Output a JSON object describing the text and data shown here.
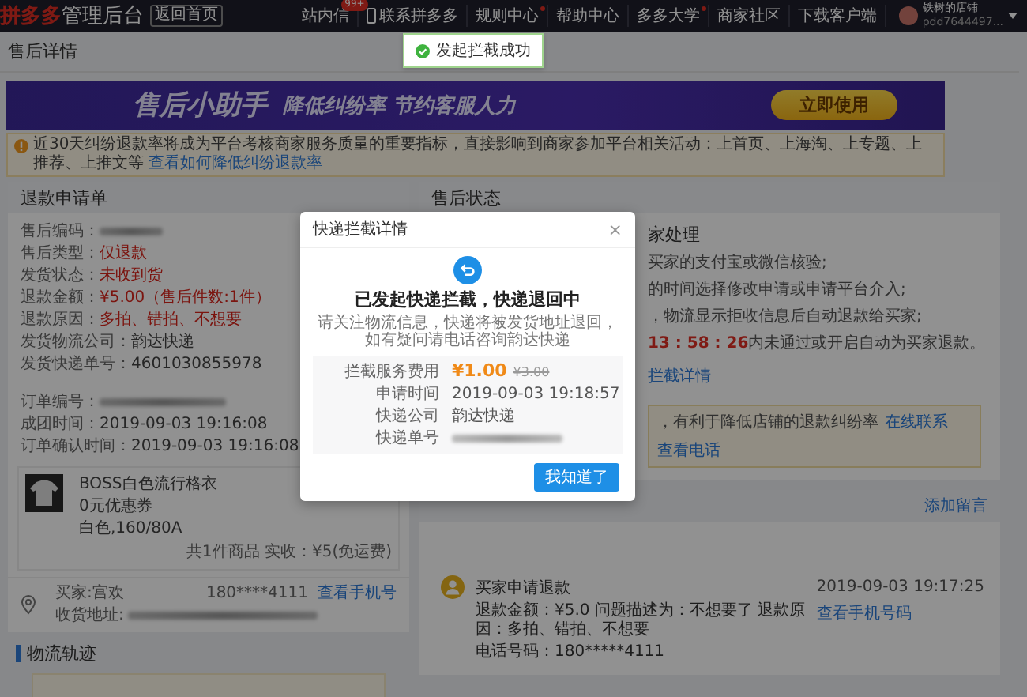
{
  "topbar": {
    "brand": "拼多多",
    "title": "管理后台",
    "home_button": "返回首页",
    "nav": [
      {
        "label": "站内信",
        "kind": "text",
        "badge": "99+",
        "dot": false
      },
      {
        "label": "联系拼多多",
        "kind": "phone",
        "dot": false
      },
      {
        "label": "规则中心",
        "kind": "text",
        "dot": true
      },
      {
        "label": "帮助中心",
        "kind": "text",
        "dot": false
      },
      {
        "label": "多多大学",
        "kind": "text",
        "dot": true
      },
      {
        "label": "商家社区",
        "kind": "text",
        "dot": false
      },
      {
        "label": "下载客户端",
        "kind": "text",
        "dot": false
      }
    ],
    "user": {
      "name": "铁树的店铺",
      "id": "pdd7644497..."
    }
  },
  "page_title": "售后详情",
  "banner": {
    "title": "售后小助手",
    "slogan": "降低纠纷率 节约客服人力",
    "button": "立即使用"
  },
  "notice": {
    "text": "近30天纠纷退款率将成为平台考核商家服务质量的重要指标，直接影响到商家参加平台相关活动：上首页、上海淘、上专题、上推荐、上推文等",
    "link": "查看如何降低纠纷退款率"
  },
  "refund_panel": {
    "title": "退款申请单",
    "rows": [
      {
        "label": "售后编码：",
        "kind": "blurred"
      },
      {
        "label": "售后类型：",
        "kind": "text",
        "value": "仅退款",
        "emphasis": true
      },
      {
        "label": "发货状态：",
        "kind": "text",
        "value": "未收到货",
        "emphasis": true
      },
      {
        "label": "退款金额：",
        "kind": "text",
        "value": "¥5.00（售后件数:1件）",
        "emphasis": true
      },
      {
        "label": "退款原因：",
        "kind": "text",
        "value": "多拍、错拍、不想要",
        "emphasis": true
      },
      {
        "label": "发货物流公司：",
        "kind": "text",
        "value": "韵达快递",
        "emphasis": false
      },
      {
        "label": "发货快递单号：",
        "kind": "text",
        "value": "4601030855978",
        "emphasis": false
      }
    ],
    "order_rows": [
      {
        "label": "订单编号：",
        "kind": "blurred"
      },
      {
        "label": "成团时间：",
        "kind": "text",
        "value": "2019-09-03 19:16:08"
      },
      {
        "label": "订单确认时间：",
        "kind": "text",
        "value": "2019-09-03 19:16:08"
      }
    ],
    "product": {
      "name": "BOSS白色流行格衣",
      "coupon": "0元优惠券",
      "spec": "白色,160/80A",
      "summary": "共1件商品  实收：¥5(免运费)"
    },
    "address": {
      "buyer": "买家:宫欢",
      "phone": "180****4111",
      "phone_link": "查看手机号",
      "address_label": "收货地址:"
    }
  },
  "logistics_title": "物流轨迹",
  "status_panel": {
    "title": "售后状态",
    "heading": "家处理",
    "lines": [
      "买家的支付宝或微信核验;",
      "的时间选择修改申请或申请平台介入;",
      "，物流显示拒收信息后自动退款给买家;"
    ],
    "countdown": "13 : 58 : 26",
    "countdown_text": "内未通过或开启自动为买家退款。",
    "detail_link": "拦截详情",
    "tip": {
      "text": "，有利于降低店铺的退款纠纷率",
      "links": [
        "在线联系",
        "查看电话"
      ]
    }
  },
  "message_panel": {
    "add_link": "添加留言",
    "entries": [
      {
        "title": "买家申请退款",
        "time": "2019-09-03 19:17:25",
        "text": "退款金额：¥5.0 问题描述为：不想要了 退款原因：多拍、错拍、不想要",
        "phone": "电话号码：180*****4111",
        "link": "查看手机号码"
      }
    ]
  },
  "toast": {
    "text": "发起拦截成功"
  },
  "modal": {
    "title": "快递拦截详情",
    "close": "×",
    "heading": "已发起快递拦截，快递退回中",
    "description": "请关注物流信息，快递将被发货地址退回，如有疑问请电话咨询韵达快递",
    "rows": [
      {
        "label": "拦截服务费用",
        "kind": "price",
        "value": "¥1.00",
        "old_value": "¥3.00"
      },
      {
        "label": "申请时间",
        "kind": "text",
        "value": "2019-09-03 19:18:57"
      },
      {
        "label": "快递公司",
        "kind": "text",
        "value": "韵达快递"
      },
      {
        "label": "快递单号",
        "kind": "blurred"
      }
    ],
    "button": "我知道了"
  }
}
